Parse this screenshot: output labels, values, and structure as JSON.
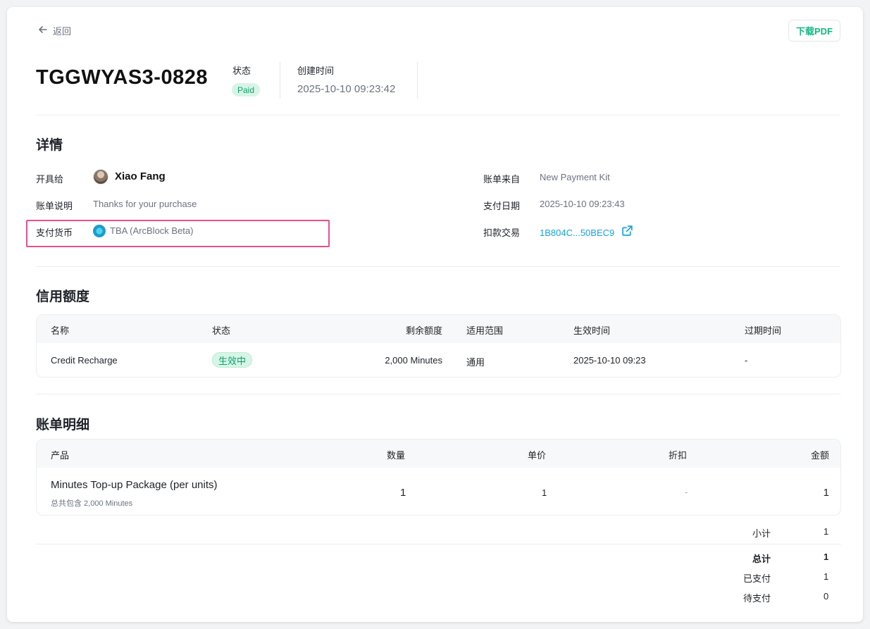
{
  "nav": {
    "back_label": "返回",
    "download_pdf": "下载PDF"
  },
  "invoice": {
    "number": "TGGWYAS3-0828",
    "status_label": "状态",
    "status_value": "Paid",
    "created_label": "创建时间",
    "created_value": "2025-10-10 09:23:42"
  },
  "details": {
    "title": "详情",
    "issued_to_label": "开具给",
    "issued_to_name": "Xiao Fang",
    "description_label": "账单说明",
    "description_value": "Thanks for your purchase",
    "currency_label": "支付货币",
    "currency_value": "TBA (ArcBlock Beta)",
    "source_label": "账单来自",
    "source_value": "New Payment Kit",
    "paid_date_label": "支付日期",
    "paid_date_value": "2025-10-10 09:23:43",
    "tx_label": "扣款交易",
    "tx_value": "1B804C...50BEC9"
  },
  "credits": {
    "title": "信用额度",
    "headers": [
      "名称",
      "状态",
      "剩余额度",
      "适用范围",
      "生效时间",
      "过期时间"
    ],
    "row": {
      "name": "Credit Recharge",
      "status": "生效中",
      "remaining": "2,000 Minutes",
      "scope": "通用",
      "effective": "2025-10-10 09:23",
      "expires": "-"
    }
  },
  "items": {
    "title": "账单明细",
    "headers": [
      "产品",
      "数量",
      "单价",
      "折扣",
      "金额"
    ],
    "row": {
      "product": "Minutes Top-up Package (per units)",
      "product_sub": "总共包含 2,000 Minutes",
      "quantity": "1",
      "unit_price": "1",
      "discount": "-",
      "amount": "1"
    }
  },
  "summary": {
    "subtotal_label": "小计",
    "subtotal_value": "1",
    "total_label": "总计",
    "total_value": "1",
    "paid_label": "已支付",
    "paid_value": "1",
    "due_label": "待支付",
    "due_value": "0"
  },
  "colors": {
    "accent_green": "#10b981",
    "badge_bg": "#d7f5e6",
    "link": "#1aa3d9",
    "highlight": "#e6508f"
  },
  "icons": [
    "arrow-left-icon",
    "avatar",
    "token-icon",
    "external-link-icon"
  ]
}
